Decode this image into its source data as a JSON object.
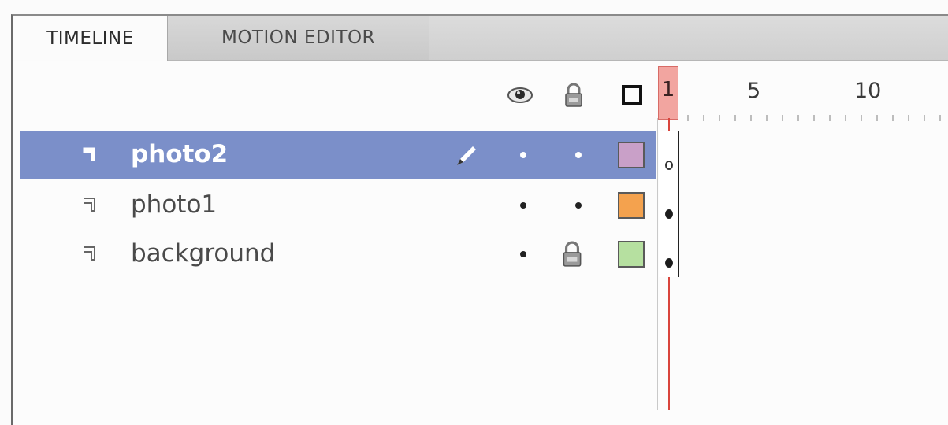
{
  "tabs": [
    {
      "label": "TIMELINE",
      "active": true
    },
    {
      "label": "MOTION EDITOR",
      "active": false
    }
  ],
  "header": {
    "show_hide_icon": "eye-icon",
    "lock_icon": "lock-icon",
    "outline_icon": "outline-square-icon"
  },
  "ruler": {
    "labels": [
      "1",
      "5",
      "10"
    ],
    "current_frame": "1"
  },
  "layers": [
    {
      "name": "photo2",
      "selected": true,
      "editing": true,
      "visible": true,
      "locked": false,
      "outline_color": "#c9a0c8",
      "keyframe": "empty"
    },
    {
      "name": "photo1",
      "selected": false,
      "editing": false,
      "visible": true,
      "locked": false,
      "outline_color": "#f4a24e",
      "keyframe": "filled"
    },
    {
      "name": "background",
      "selected": false,
      "editing": false,
      "visible": true,
      "locked": true,
      "outline_color": "#b6e0a0",
      "keyframe": "filled"
    }
  ],
  "colors": {
    "selection": "#7b8fc9",
    "playhead": "#d9443c",
    "playhead_head": "#f2a5a0"
  }
}
